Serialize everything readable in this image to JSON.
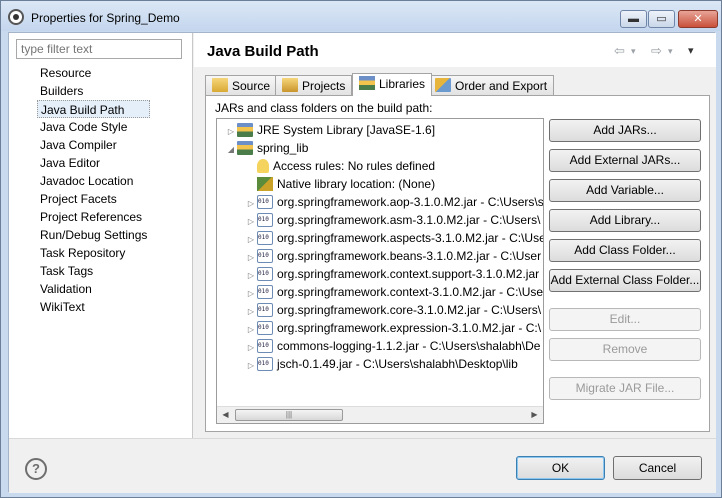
{
  "window": {
    "title": "Properties for Spring_Demo",
    "min_label": "▬",
    "max_label": "▭",
    "close_label": "✕"
  },
  "filter": {
    "placeholder": "type filter text"
  },
  "nav": {
    "items": [
      "Resource",
      "Builders",
      "Java Build Path",
      "Java Code Style",
      "Java Compiler",
      "Java Editor",
      "Javadoc Location",
      "Project Facets",
      "Project References",
      "Run/Debug Settings",
      "Task Repository",
      "Task Tags",
      "Validation",
      "WikiText"
    ],
    "selected": "Java Build Path"
  },
  "page": {
    "title": "Java Build Path"
  },
  "history": {
    "back": "⇦",
    "back_menu": "▾",
    "forward": "⇨",
    "forward_menu": "▾",
    "view_menu": "▾"
  },
  "tabs": [
    {
      "label": "Source",
      "icon": "source-folder-icon"
    },
    {
      "label": "Projects",
      "icon": "projects-icon"
    },
    {
      "label": "Libraries",
      "icon": "libraries-icon",
      "active": true
    },
    {
      "label": "Order and Export",
      "icon": "order-export-icon"
    }
  ],
  "libraries": {
    "heading": "JARs and class folders on the build path:",
    "tree": [
      {
        "text": "JRE System Library [JavaSE-1.6]",
        "icon": "library-icon",
        "expanded": false
      },
      {
        "text": "spring_lib",
        "icon": "library-icon",
        "expanded": true
      },
      {
        "text": "Access rules: No rules defined",
        "icon": "access-rules-icon"
      },
      {
        "text": "Native library location: (None)",
        "icon": "native-library-icon"
      },
      {
        "text": "org.springframework.aop-3.1.0.M2.jar - C:\\Users\\s",
        "icon": "jar-icon"
      },
      {
        "text": "org.springframework.asm-3.1.0.M2.jar - C:\\Users\\",
        "icon": "jar-icon"
      },
      {
        "text": "org.springframework.aspects-3.1.0.M2.jar - C:\\Use",
        "icon": "jar-icon"
      },
      {
        "text": "org.springframework.beans-3.1.0.M2.jar - C:\\User",
        "icon": "jar-icon"
      },
      {
        "text": "org.springframework.context.support-3.1.0.M2.jar",
        "icon": "jar-icon"
      },
      {
        "text": "org.springframework.context-3.1.0.M2.jar - C:\\Use",
        "icon": "jar-icon"
      },
      {
        "text": "org.springframework.core-3.1.0.M2.jar - C:\\Users\\",
        "icon": "jar-icon"
      },
      {
        "text": "org.springframework.expression-3.1.0.M2.jar - C:\\",
        "icon": "jar-icon"
      },
      {
        "text": "commons-logging-1.1.2.jar - C:\\Users\\shalabh\\De",
        "icon": "jar-icon"
      },
      {
        "text": "jsch-0.1.49.jar - C:\\Users\\shalabh\\Desktop\\lib",
        "icon": "jar-icon"
      }
    ],
    "scroll": {
      "left": "◀",
      "thumb": "|||",
      "right": "▶"
    },
    "buttons": [
      {
        "label": "Add JARs...",
        "enabled": true
      },
      {
        "label": "Add External JARs...",
        "enabled": true
      },
      {
        "label": "Add Variable...",
        "enabled": true
      },
      {
        "label": "Add Library...",
        "enabled": true
      },
      {
        "label": "Add Class Folder...",
        "enabled": true
      },
      {
        "label": "Add External Class Folder...",
        "enabled": true
      },
      {
        "label": "Edit...",
        "enabled": false
      },
      {
        "label": "Remove",
        "enabled": false
      },
      {
        "label": "Migrate JAR File...",
        "enabled": false
      }
    ]
  },
  "footer": {
    "help": "?",
    "ok": "OK",
    "cancel": "Cancel"
  }
}
